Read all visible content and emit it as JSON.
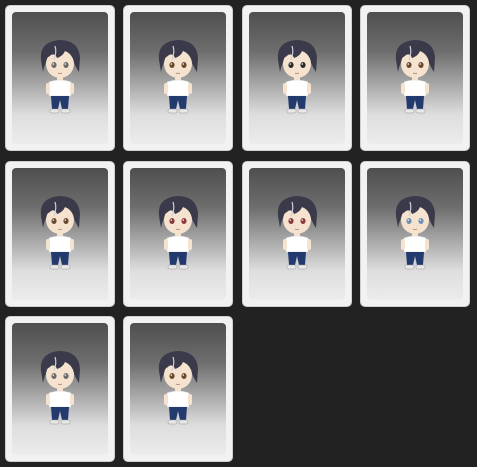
{
  "grid": {
    "columns": 4,
    "cards": [
      {
        "eyes": "grey",
        "mouth": "neutral",
        "skin": "#f5e3cf"
      },
      {
        "eyes": "brown",
        "mouth": "neutral",
        "skin": "#f5e3cf"
      },
      {
        "eyes": "dark",
        "mouth": "neutral",
        "skin": "#f5e3cf"
      },
      {
        "eyes": "brown",
        "mouth": "neutral",
        "skin": "#f5e3cf"
      },
      {
        "eyes": "brown",
        "mouth": "neutral",
        "skin": "#f5e3cf"
      },
      {
        "eyes": "red",
        "mouth": "neutral",
        "skin": "#f5e3cf"
      },
      {
        "eyes": "red",
        "mouth": "neutral",
        "skin": "#f5e3cf"
      },
      {
        "eyes": "blue",
        "mouth": "neutral",
        "skin": "#f5e3cf"
      },
      {
        "eyes": "grey",
        "mouth": "neutral",
        "skin": "#f5e3cf"
      },
      {
        "eyes": "brown",
        "mouth": "neutral",
        "skin": "#f5e3cf"
      }
    ]
  },
  "colors": {
    "background": "#222222",
    "hair": "#3a3a4a",
    "shirt": "#ffffff",
    "pants": "#233a6e",
    "shoes": "#e8e8e8"
  }
}
